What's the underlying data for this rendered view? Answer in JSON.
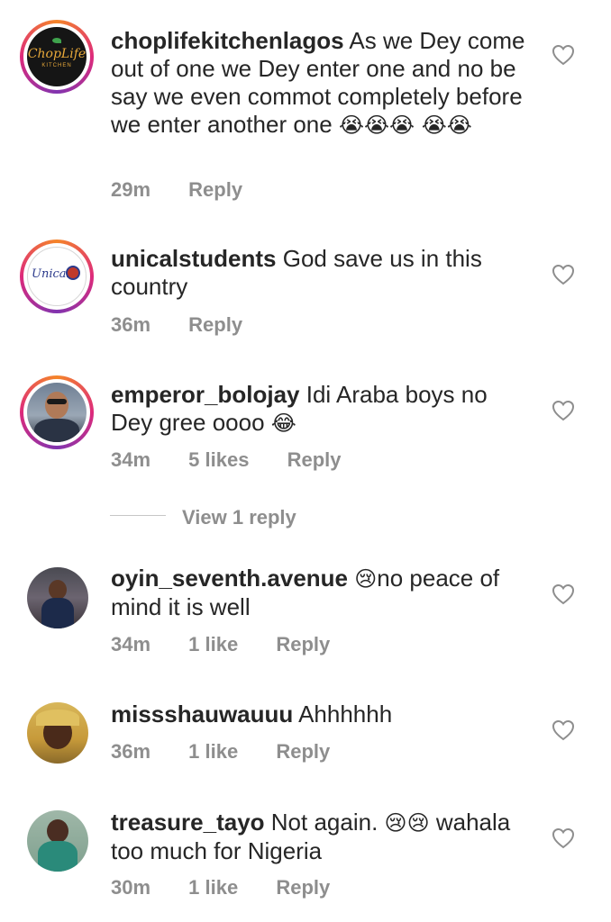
{
  "comments": [
    {
      "username": "choplifekitchenlagos",
      "text": "As we Dey come out of one we Dey enter one and no be say we even commot completely before we enter another one",
      "emojis": "😭😭😭 😭😭",
      "time": "29m",
      "likes": "",
      "reply": "Reply",
      "avatar_logo": "ChopLife",
      "avatar_sub": "KITCHEN"
    },
    {
      "username": "unicalstudents",
      "text": "God save us in this country",
      "emojis": "",
      "time": "36m",
      "likes": "",
      "reply": "Reply",
      "avatar_logo": "Unical"
    },
    {
      "username": "emperor_bolojay",
      "text": "Idi Araba boys no Dey gree oooo",
      "emojis": "😂",
      "time": "34m",
      "likes": "5 likes",
      "reply": "Reply"
    },
    {
      "username": "oyin_seventh.avenue",
      "text": "no peace of mind  it is well",
      "emojis": "😢",
      "time": "34m",
      "likes": "1 like",
      "reply": "Reply"
    },
    {
      "username": "missshauwauuu",
      "text": "Ahhhhhh",
      "emojis": "",
      "time": "36m",
      "likes": "1 like",
      "reply": "Reply"
    },
    {
      "username": "treasure_tayo",
      "text": "Not again.",
      "text2": "wahala too much for Nigeria",
      "emojis": "😢😢",
      "time": "30m",
      "likes": "1 like",
      "reply": "Reply"
    }
  ],
  "view_replies": "View 1 reply",
  "icons": {
    "like": "heart-icon"
  },
  "colors": {
    "text": "#262626",
    "meta": "#8e8e8e",
    "ring_start": "#f58529",
    "ring_end": "#dd2a7b"
  }
}
